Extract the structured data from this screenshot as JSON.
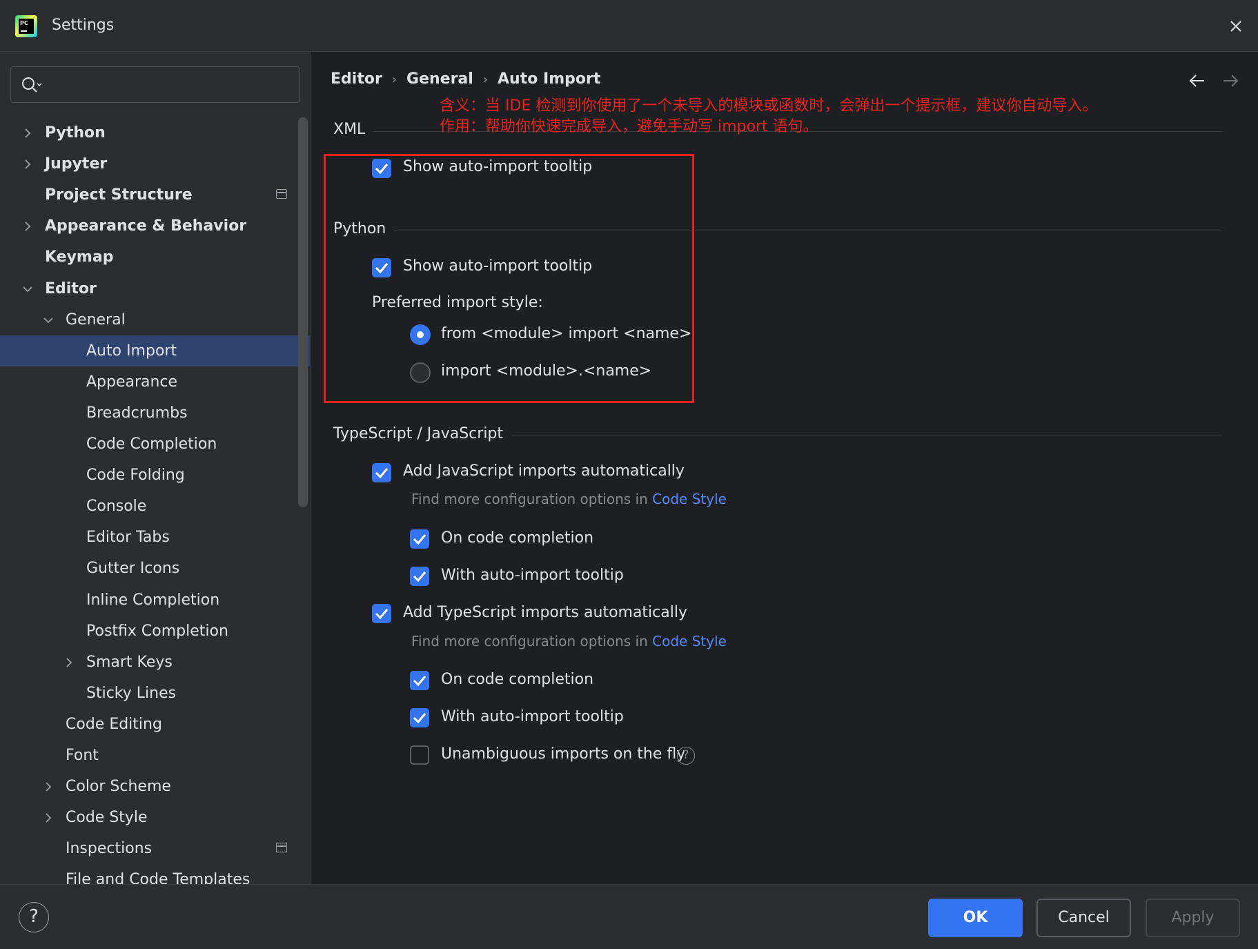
{
  "window": {
    "title": "Settings",
    "logo_text": "PC"
  },
  "search": {
    "placeholder": "",
    "value": ""
  },
  "sidebar": {
    "items": [
      {
        "label": "Python",
        "level": 0,
        "expander": "collapsed",
        "bold": true
      },
      {
        "label": "Jupyter",
        "level": 0,
        "expander": "collapsed",
        "bold": true
      },
      {
        "label": "Project Structure",
        "level": 0,
        "expander": "none",
        "bold": true,
        "project_icon": true
      },
      {
        "label": "Appearance & Behavior",
        "level": 0,
        "expander": "collapsed",
        "bold": true
      },
      {
        "label": "Keymap",
        "level": 0,
        "expander": "none",
        "bold": true
      },
      {
        "label": "Editor",
        "level": 0,
        "expander": "expanded",
        "bold": true
      },
      {
        "label": "General",
        "level": 1,
        "expander": "expanded"
      },
      {
        "label": "Auto Import",
        "level": 2,
        "expander": "none",
        "selected": true
      },
      {
        "label": "Appearance",
        "level": 2,
        "expander": "none"
      },
      {
        "label": "Breadcrumbs",
        "level": 2,
        "expander": "none"
      },
      {
        "label": "Code Completion",
        "level": 2,
        "expander": "none"
      },
      {
        "label": "Code Folding",
        "level": 2,
        "expander": "none"
      },
      {
        "label": "Console",
        "level": 2,
        "expander": "none"
      },
      {
        "label": "Editor Tabs",
        "level": 2,
        "expander": "none"
      },
      {
        "label": "Gutter Icons",
        "level": 2,
        "expander": "none"
      },
      {
        "label": "Inline Completion",
        "level": 2,
        "expander": "none"
      },
      {
        "label": "Postfix Completion",
        "level": 2,
        "expander": "none"
      },
      {
        "label": "Smart Keys",
        "level": 2,
        "expander": "collapsed"
      },
      {
        "label": "Sticky Lines",
        "level": 2,
        "expander": "none"
      },
      {
        "label": "Code Editing",
        "level": 1,
        "expander": "none"
      },
      {
        "label": "Font",
        "level": 1,
        "expander": "none"
      },
      {
        "label": "Color Scheme",
        "level": 1,
        "expander": "collapsed"
      },
      {
        "label": "Code Style",
        "level": 1,
        "expander": "collapsed"
      },
      {
        "label": "Inspections",
        "level": 1,
        "expander": "none",
        "project_icon": true
      },
      {
        "label": "File and Code Templates",
        "level": 1,
        "expander": "none"
      }
    ]
  },
  "breadcrumb": [
    "Editor",
    "General",
    "Auto Import"
  ],
  "annotation": {
    "line1": "含义：当 IDE 检测到你使用了一个未导入的模块或函数时，会弹出一个提示框，建议你自动导入。",
    "line2": "作用：帮助你快速完成导入，避免手动写 import 语句。"
  },
  "xml": {
    "title": "XML",
    "show_tooltip": {
      "label": "Show auto-import tooltip",
      "checked": true
    }
  },
  "python": {
    "title": "Python",
    "show_tooltip": {
      "label": "Show auto-import tooltip",
      "checked": true
    },
    "import_style_label": "Preferred import style:",
    "import_style_options": [
      {
        "label": "from <module> import <name>",
        "selected": true
      },
      {
        "label": "import <module>.<name>",
        "selected": false
      }
    ]
  },
  "ts_js": {
    "title": "TypeScript / JavaScript",
    "add_js": {
      "label": "Add JavaScript imports automatically",
      "checked": true
    },
    "js_hint": {
      "text": "Find more configuration options in ",
      "link": "Code Style"
    },
    "js_on_completion": {
      "label": "On code completion",
      "checked": true
    },
    "js_with_tooltip": {
      "label": "With auto-import tooltip",
      "checked": true
    },
    "add_ts": {
      "label": "Add TypeScript imports automatically",
      "checked": true
    },
    "ts_hint": {
      "text": "Find more configuration options in ",
      "link": "Code Style"
    },
    "ts_on_completion": {
      "label": "On code completion",
      "checked": true
    },
    "ts_with_tooltip": {
      "label": "With auto-import tooltip",
      "checked": true
    },
    "unambiguous": {
      "label": "Unambiguous imports on the fly",
      "checked": false
    }
  },
  "footer": {
    "help": "?",
    "ok": "OK",
    "cancel": "Cancel",
    "apply": "Apply"
  },
  "colors": {
    "accent": "#3574f0",
    "selection": "#2e436e",
    "annotation_red": "#e8231f",
    "link": "#548af7"
  }
}
